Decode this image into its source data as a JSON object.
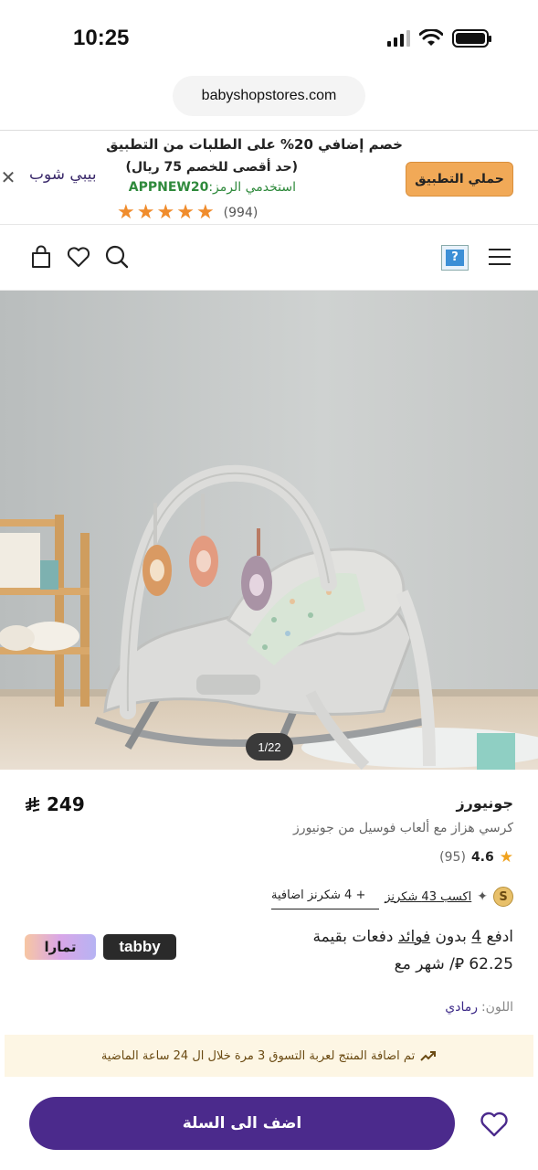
{
  "status_bar": {
    "time": "10:25"
  },
  "browser": {
    "url": "babyshopstores.com"
  },
  "app_banner": {
    "close_icon": "close-icon",
    "brand_logo": "بيبي شوب",
    "line1": "خصم إضافي 20% على الطلبات من التطبيق",
    "line2": "(حد أقصى للخصم 75 ريال)",
    "code_label": "استخدمي الرمز:",
    "code": "APPNEW20",
    "rating_stars": 5,
    "rating_count": "(994)",
    "download_button": "حملي التطبيق"
  },
  "site_header": {
    "icons": [
      "menu-icon",
      "help-icon",
      "search-icon",
      "heart-icon",
      "bag-icon"
    ]
  },
  "product_gallery": {
    "counter": "1/22"
  },
  "product": {
    "brand": "جونيورز",
    "title": "كرسي هزاز مع ألعاب فوسيل من جونيورز",
    "price": "249",
    "currency_symbol": "⃁",
    "rating": "4.6",
    "rating_count": "(95)",
    "points_text": "اكسب 43 شكرنز",
    "points_extra": "+ 4    شكرنز اضافية",
    "installments_line1": "ادفع 4 بدون فوائد دفعات بقيمة",
    "installments_part_a": "ادفع ",
    "installments_num": "4",
    "installments_part_b": " بدون ",
    "installments_fees": "فوائد",
    "installments_part_c": " دفعات بقيمة",
    "installments_line2": "62.25 ⃁/ شهر مع",
    "tabby_label": "tabby",
    "tamara_label": "تمارا",
    "color_label": "اللون:",
    "color_value": "رمادي"
  },
  "notice": {
    "text": "تم اضافة المنتج لعربة التسوق 3 مرة خلال ال 24 ساعة الماضية",
    "icon": "trending-up-icon"
  },
  "bottom_bar": {
    "add_to_cart": "اضف الى السلة",
    "wishlist_icon": "heart-icon"
  },
  "colors": {
    "primary": "#4b2a8c",
    "banner_button": "#f1a957",
    "star": "#f08c2c",
    "code_green": "#2f8a3c",
    "notice_bg": "#fdf6e4"
  }
}
